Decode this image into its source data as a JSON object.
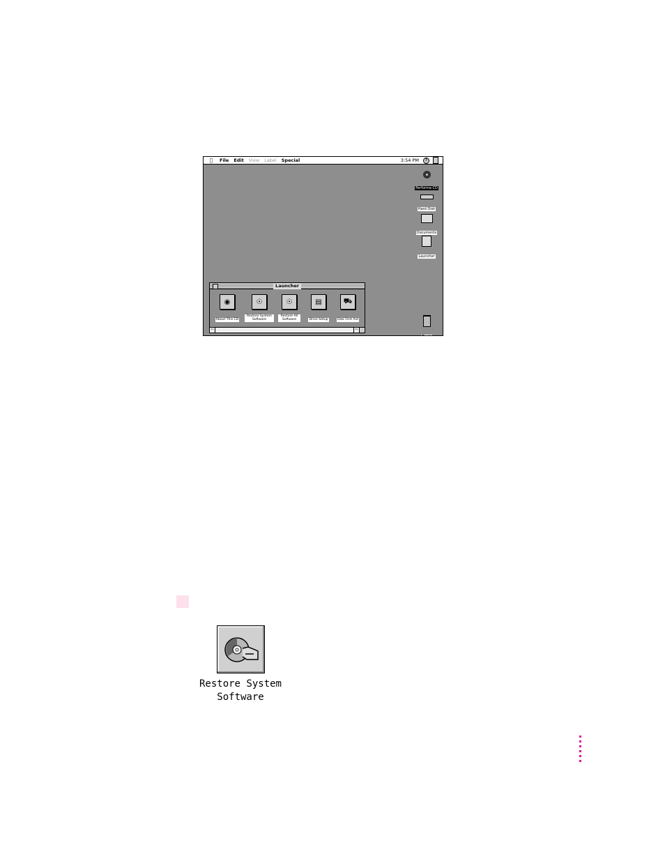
{
  "screen": {
    "menubar": {
      "apple_icon": "apple-icon",
      "menus": [
        {
          "label": "File",
          "enabled": true
        },
        {
          "label": "Edit",
          "enabled": true
        },
        {
          "label": "View",
          "enabled": false
        },
        {
          "label": "Label",
          "enabled": false
        },
        {
          "label": "Special",
          "enabled": true
        }
      ],
      "clock": "3:54 PM",
      "help_icon": "help-balloon-icon",
      "app_icon": "finder-application-icon"
    },
    "desktop_icons": [
      {
        "label": "Performa CD",
        "icon": "cd-icon",
        "selected": true
      },
      {
        "label": "Hard Disk",
        "icon": "hard-disk-icon",
        "selected": false
      },
      {
        "label": "Documents",
        "icon": "folder-icon",
        "selected": false
      },
      {
        "label": "Launcher",
        "icon": "launcher-icon",
        "selected": false
      },
      {
        "label": "Trash",
        "icon": "trash-icon",
        "selected": false
      }
    ],
    "launcher": {
      "title": "Launcher",
      "items": [
        {
          "label": "About This CD",
          "icon": "about-cd-icon"
        },
        {
          "label": "Restore System Software",
          "icon": "restore-system-icon"
        },
        {
          "label": "Restore All Software",
          "icon": "restore-all-icon"
        },
        {
          "label": "Drive Setup",
          "icon": "drive-setup-icon"
        },
        {
          "label": "Disk First Aid",
          "icon": "disk-first-aid-icon"
        }
      ]
    }
  },
  "large_icon": {
    "label_line1": "Restore System",
    "label_line2": "Software",
    "icon": "restore-system-icon"
  },
  "colors": {
    "desktop": "#8e8e8e",
    "marker_pink": "#fde0ec",
    "margin_dots": "#e0109a"
  }
}
